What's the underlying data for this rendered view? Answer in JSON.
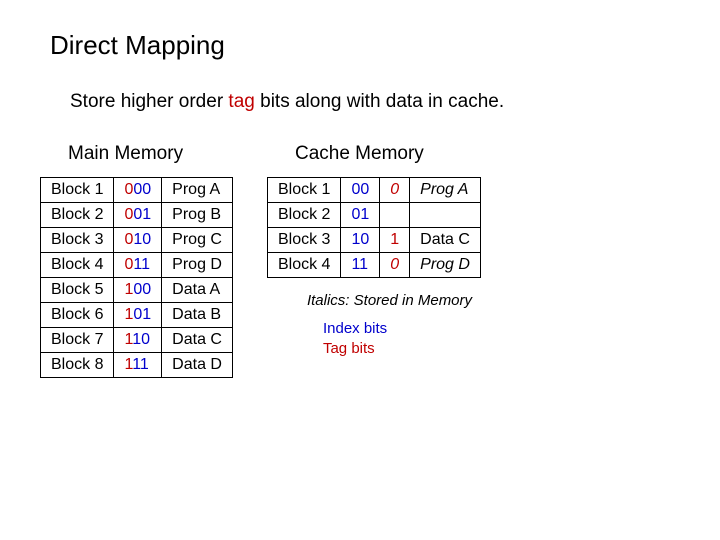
{
  "title": "Direct Mapping",
  "subtitle_pre": "Store higher order ",
  "subtitle_tag": "tag",
  "subtitle_post": " bits along with data in cache.",
  "main_memory": {
    "title": "Main Memory",
    "rows": [
      {
        "block": "Block 1",
        "tag": "0",
        "index": "00",
        "content": "Prog A"
      },
      {
        "block": "Block 2",
        "tag": "0",
        "index": "01",
        "content": "Prog B"
      },
      {
        "block": "Block 3",
        "tag": "0",
        "index": "10",
        "content": "Prog C"
      },
      {
        "block": "Block 4",
        "tag": "0",
        "index": "11",
        "content": "Prog D"
      },
      {
        "block": "Block 5",
        "tag": "1",
        "index": "00",
        "content": "Data A"
      },
      {
        "block": "Block 6",
        "tag": "1",
        "index": "01",
        "content": "Data B"
      },
      {
        "block": "Block 7",
        "tag": "1",
        "index": "10",
        "content": "Data C"
      },
      {
        "block": "Block 8",
        "tag": "1",
        "index": "11",
        "content": "Data D"
      }
    ]
  },
  "cache_memory": {
    "title": "Cache Memory",
    "rows": [
      {
        "block": "Block 1",
        "index": "00",
        "tag": "0",
        "content": "Prog A",
        "italic": true
      },
      {
        "block": "Block 2",
        "index": "01",
        "tag": "",
        "content": "",
        "italic": false
      },
      {
        "block": "Block 3",
        "index": "10",
        "tag": "1",
        "content": "Data C",
        "italic": false
      },
      {
        "block": "Block 4",
        "index": "11",
        "tag": "0",
        "content": "Prog D",
        "italic": true
      }
    ]
  },
  "note_italics": "Italics:  Stored in Memory",
  "legend_index": "Index bits",
  "legend_tag": "Tag bits"
}
